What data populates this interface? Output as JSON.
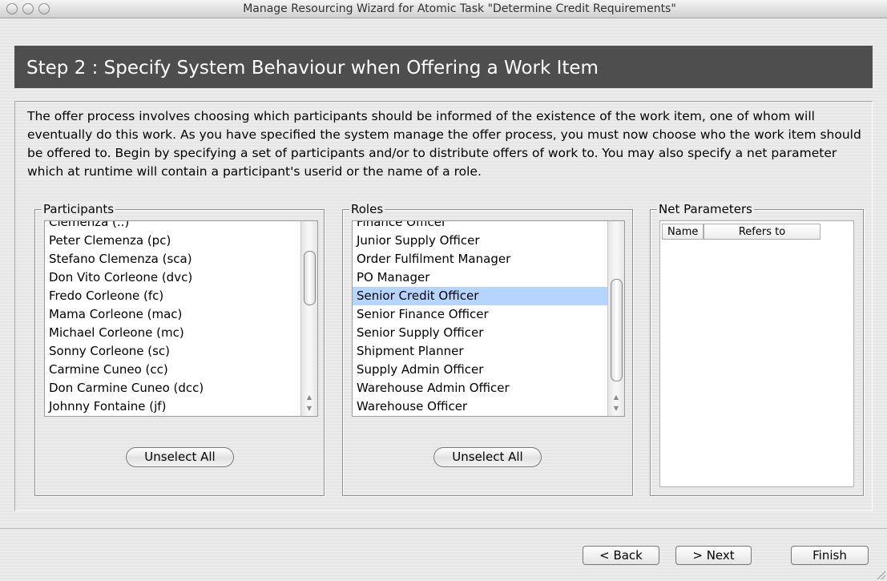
{
  "window": {
    "title": "Manage Resourcing Wizard for Atomic Task \"Determine Credit Requirements\""
  },
  "header": {
    "step_title": "Step 2 : Specify System Behaviour when Offering a Work Item"
  },
  "intro": {
    "text": "The offer process involves choosing which participants should be informed of the existence of the work item, one of whom will eventually do this work. As you have specified the system manage the offer process, you must now choose who the work item should be offered to. Begin by specifying a set of participants and/or to distribute offers of work to. You may also specify a net parameter which at runtime will contain a participant's userid or the name of a role."
  },
  "participants": {
    "label": "Participants",
    "items": [
      "Clemenza (..)",
      "Peter Clemenza (pc)",
      "Stefano Clemenza (sca)",
      "Don Vito Corleone (dvc)",
      "Fredo Corleone (fc)",
      "Mama Corleone (mac)",
      "Michael Corleone (mc)",
      "Sonny Corleone (sc)",
      "Carmine Cuneo (cc)",
      "Don Carmine Cuneo (dcc)",
      "Johnny Fontaine (jf)"
    ],
    "unselect_label": "Unselect All"
  },
  "roles": {
    "label": "Roles",
    "items": [
      "Finance Officer",
      "Junior Supply Officer",
      "Order Fulfilment Manager",
      "PO Manager",
      "Senior Credit Officer",
      "Senior Finance Officer",
      "Senior Supply Officer",
      "Shipment Planner",
      "Supply Admin Officer",
      "Warehouse Admin Officer",
      "Warehouse Officer"
    ],
    "selected": "Senior Credit Officer",
    "unselect_label": "Unselect All"
  },
  "net_parameters": {
    "label": "Net Parameters",
    "columns": [
      "Name",
      "Refers to"
    ]
  },
  "footer": {
    "back_label": "< Back",
    "next_label": "> Next",
    "finish_label": "Finish"
  },
  "colors": {
    "header_bg": "#4e4e4e",
    "selection": "#b5d5ff"
  }
}
